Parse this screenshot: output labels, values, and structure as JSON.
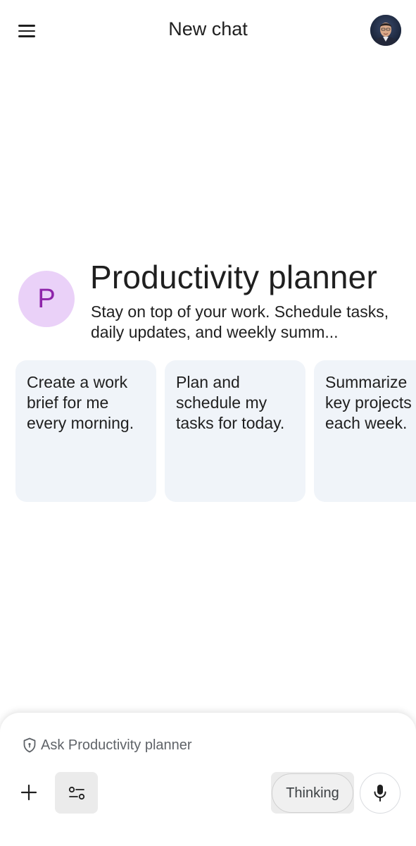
{
  "header": {
    "title": "New chat",
    "menu_icon": "hamburger-menu-icon",
    "avatar": "user-avatar"
  },
  "gem": {
    "initial": "P",
    "name": "Productivity planner",
    "description": "Stay on top of your work. Schedule tasks, daily updates, and weekly summ...",
    "icon_bg": "#ead1f8",
    "icon_fg": "#8e24aa"
  },
  "suggestions": [
    {
      "text": "Create a work\nbrief for me\nevery morning."
    },
    {
      "text": "Plan and\nschedule my\ntasks for today."
    },
    {
      "text": "Summarize\nkey projects\neach week."
    }
  ],
  "composer": {
    "placeholder": "Ask Productivity planner",
    "prompt_icon": "shield-icon",
    "add_icon": "plus-icon",
    "tools_icon": "tools-sliders-icon",
    "thinking_label": "Thinking",
    "mic_icon": "microphone-icon"
  },
  "colors": {
    "card_bg": "#f0f4f9",
    "text": "#1f1f1f",
    "muted": "#5f6368"
  }
}
